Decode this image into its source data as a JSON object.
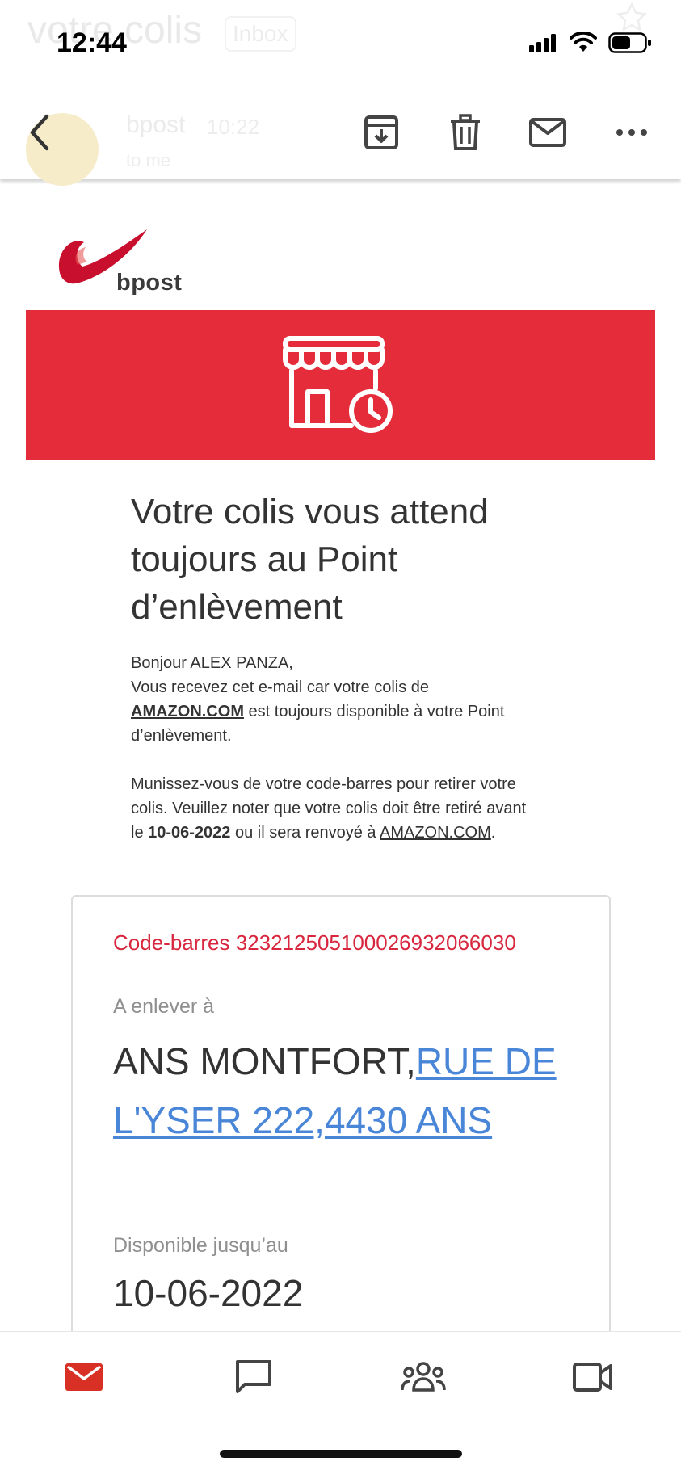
{
  "status_bar": {
    "time": "12:44",
    "faded_subject": "votre colis",
    "faded_label": "Inbox"
  },
  "header": {
    "faded_sender": "bpost",
    "faded_time": "10:22",
    "faded_recipient": "to me"
  },
  "email": {
    "logo_text": "bpost",
    "headline": "Votre colis vous attend toujours au Point d’enlèvement",
    "greeting": "Bonjour ALEX PANZA,",
    "para1_before": "Vous recevez cet e-mail car votre colis de ",
    "para1_link": "AMAZON.COM",
    "para1_after": " est toujours disponible à votre Point d’enlèvement.",
    "para2_before": "Munissez-vous de votre code-barres pour retirer votre colis. Veuillez noter que votre colis doit être retiré avant le ",
    "para2_date": "10-06-2022",
    "para2_middle": " ou il sera renvoyé à ",
    "para2_link": "AMAZON.COM",
    "para2_after": ".",
    "card": {
      "barcode": "Code-barres 323212505100026932066030",
      "pickup_label": "A enlever à",
      "pickup_name": "ANS MONTFORT,",
      "pickup_address_link": "RUE DE L'YSER 222,4430 ANS",
      "available_label": "Disponible jusqu’au",
      "available_date": "10-06-2022"
    }
  },
  "colors": {
    "brand_red": "#e42c3a",
    "barcode_red": "#d7263d",
    "link_blue": "#4a86d8",
    "nav_active": "#d93025"
  },
  "icons": {
    "header": [
      "back-arrow-icon",
      "archive-icon",
      "trash-icon",
      "mail-icon",
      "more-icon"
    ],
    "nav": [
      "mail-icon",
      "chat-icon",
      "meet-icon",
      "video-icon"
    ],
    "banner": "store-clock-icon"
  }
}
